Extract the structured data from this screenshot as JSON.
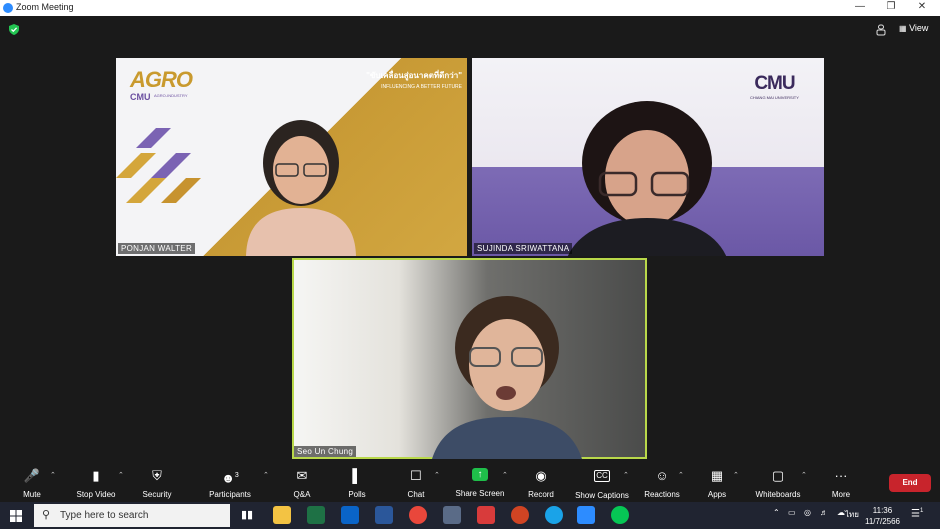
{
  "window": {
    "title": "Zoom Meeting"
  },
  "view_label": "View",
  "tiles": [
    {
      "name": "PONJAN WALTER",
      "org_logo": "AGRO",
      "org_logo_sub": "CMU",
      "org_small": "AGRO-INDUSTRY",
      "slogan": "\"ขับเคลื่อนสู่อนาคตที่ดีกว่า\"",
      "slogan_en": "INFLUENCING A BETTER FUTURE"
    },
    {
      "name": "SUJINDA SRIWATTANA",
      "logo": "CMU",
      "logo_sub": "CHIANG MAI UNIVERSITY"
    },
    {
      "name": "Seo Un Chung",
      "active_speaker": true
    }
  ],
  "toolbar": {
    "mute": "Mute",
    "stop_video": "Stop Video",
    "security": "Security",
    "participants": "Participants",
    "participants_count": "3",
    "qa": "Q&A",
    "polls": "Polls",
    "chat": "Chat",
    "share_screen": "Share Screen",
    "record": "Record",
    "show_captions": "Show Captions",
    "reactions": "Reactions",
    "apps": "Apps",
    "whiteboards": "Whiteboards",
    "more": "More",
    "end": "End"
  },
  "taskbar": {
    "search_placeholder": "Type here to search",
    "lang": "ไทย",
    "time": "11:36",
    "date": "11/7/2566",
    "notification_count": "1"
  },
  "colors": {
    "active_speaker_border": "#b9d84a",
    "share_green": "#1fbf4a",
    "end_red": "#c8242c",
    "zoom_blue": "#2d8cff"
  }
}
